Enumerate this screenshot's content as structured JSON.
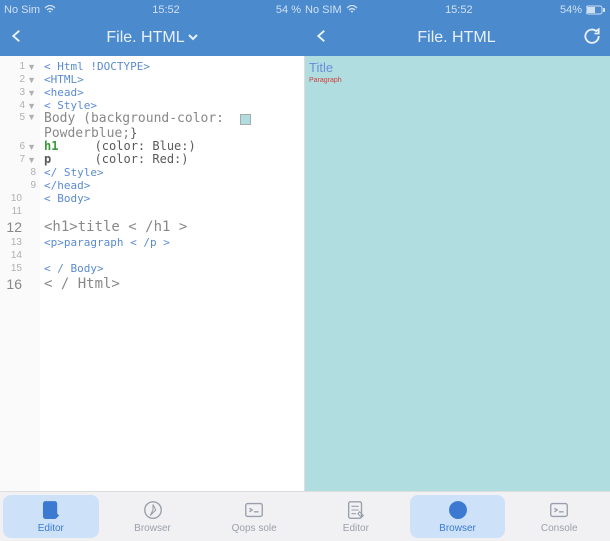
{
  "status_left": {
    "carrier": "No Sim",
    "time": "15:52",
    "battery_pct": "54 %"
  },
  "status_right": {
    "carrier": "No SIM",
    "time": "15:52",
    "battery_pct": "54%"
  },
  "nav_left": {
    "title": "File. HTML",
    "has_dropdown": true
  },
  "nav_right": {
    "title": "File. HTML"
  },
  "editor": {
    "lines": [
      {
        "n": 1,
        "fold": true,
        "text": "< Html !DOCTYPE>",
        "cls": "kw-blue"
      },
      {
        "n": 2,
        "fold": true,
        "text": "<HTML>",
        "cls": "kw-blue"
      },
      {
        "n": 3,
        "fold": true,
        "text": "<head>",
        "cls": "kw-blue"
      },
      {
        "n": 4,
        "fold": true,
        "text": "< Style>",
        "cls": "kw-blue"
      },
      {
        "n": 5,
        "fold": true,
        "tall": true,
        "parts": [
          {
            "t": "Body (background-color:  ",
            "cls": "kw-darkgray"
          },
          {
            "swatch": true
          },
          {
            "t": "\nPowderblue;",
            "cls": "kw-darkgray"
          },
          {
            "t": "}",
            "cls": "kw-black"
          }
        ]
      },
      {
        "n": 6,
        "fold": true,
        "parts": [
          {
            "t": "h1     ",
            "cls": "kw-green"
          },
          {
            "t": "(color: Blue:)",
            "cls": "kw-black"
          }
        ]
      },
      {
        "n": 7,
        "fold": true,
        "parts": [
          {
            "t": "p      ",
            "cls": "kw-pblack"
          },
          {
            "t": "(color: Red:)",
            "cls": "kw-black"
          }
        ]
      },
      {
        "n": 8,
        "fold": false,
        "text": "</ Style>",
        "cls": "kw-blue"
      },
      {
        "n": 9,
        "fold": false,
        "text": "</head>",
        "cls": "kw-blue"
      },
      {
        "n": 10,
        "fold": false,
        "text": "< Body>",
        "cls": "kw-blue",
        "outdent": true
      },
      {
        "n": 11,
        "fold": false,
        "text": "",
        "outdent": true
      },
      {
        "n": 12,
        "fold": false,
        "text": "<h1>title < /h1 > ",
        "cls": "big-row",
        "outdent": true
      },
      {
        "n": 13,
        "fold": false,
        "text": "<p>paragraph < /p >",
        "cls": "kw-blue",
        "outdent": true
      },
      {
        "n": 14,
        "fold": false,
        "text": "",
        "outdent": true
      },
      {
        "n": 15,
        "fold": false,
        "text": "< / Body>",
        "cls": "kw-blue",
        "outdent": true
      },
      {
        "n": 16,
        "fold": false,
        "text": "< / Html>",
        "cls": "big-row",
        "outdent": true
      }
    ]
  },
  "preview": {
    "title_text": "Title ",
    "paragraph_text": "Paragraph"
  },
  "tabs": {
    "left": [
      {
        "id": "editor",
        "label": "Editor",
        "icon": "editor-icon",
        "active": true
      },
      {
        "id": "browser",
        "label": "Browser",
        "icon": "compass-icon",
        "active": false
      },
      {
        "id": "console",
        "label": "Qops sole",
        "icon": "console-icon",
        "active": false
      }
    ],
    "right": [
      {
        "id": "editor2",
        "label": "Editor",
        "icon": "editor-icon",
        "active": false
      },
      {
        "id": "browser2",
        "label": "Browser",
        "icon": "compass-icon",
        "active": true
      },
      {
        "id": "console2",
        "label": "Console",
        "icon": "console-icon",
        "active": false
      }
    ]
  }
}
